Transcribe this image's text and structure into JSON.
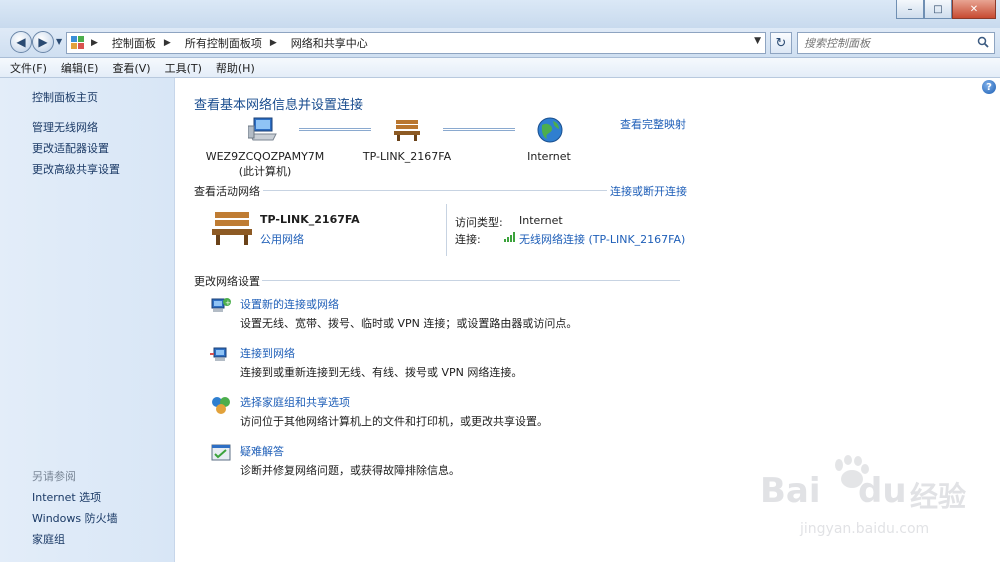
{
  "window": {
    "minimize": "–",
    "maximize": "□",
    "close": "✕"
  },
  "address": {
    "crumbs": [
      "控制面板",
      "所有控制面板项",
      "网络和共享中心"
    ],
    "search_placeholder": "搜索控制面板"
  },
  "menu": [
    "文件(F)",
    "编辑(E)",
    "查看(V)",
    "工具(T)",
    "帮助(H)"
  ],
  "sidebar": {
    "home": "控制面板主页",
    "links": [
      "管理无线网络",
      "更改适配器设置",
      "更改高级共享设置"
    ],
    "see_also_title": "另请参阅",
    "see_also": [
      "Internet 选项",
      "Windows 防火墙",
      "家庭组"
    ]
  },
  "main": {
    "title": "查看基本网络信息并设置连接",
    "view_full_map": "查看完整映射",
    "computer_name": "WEZ9ZCQOZPAMY7M",
    "computer_sub": "(此计算机)",
    "router_name": "TP-LINK_2167FA",
    "internet_label": "Internet",
    "active_title": "查看活动网络",
    "connect_disconnect": "连接或断开连接",
    "active_network_name": "TP-LINK_2167FA",
    "active_network_type": "公用网络",
    "access_type_label": "访问类型:",
    "access_type_value": "Internet",
    "connection_label": "连接:",
    "connection_value": "无线网络连接 (TP-LINK_2167FA)",
    "change_title": "更改网络设置",
    "tasks": [
      {
        "title": "设置新的连接或网络",
        "desc": "设置无线、宽带、拨号、临时或 VPN 连接；或设置路由器或访问点。",
        "icon": "new-connection-icon"
      },
      {
        "title": "连接到网络",
        "desc": "连接到或重新连接到无线、有线、拨号或 VPN 网络连接。",
        "icon": "connect-network-icon"
      },
      {
        "title": "选择家庭组和共享选项",
        "desc": "访问位于其他网络计算机上的文件和打印机，或更改共享设置。",
        "icon": "homegroup-icon"
      },
      {
        "title": "疑难解答",
        "desc": "诊断并修复网络问题，或获得故障排除信息。",
        "icon": "troubleshoot-icon"
      }
    ]
  },
  "watermark": {
    "brand": "Bai",
    "brand2": "du",
    "cn": "经验",
    "url": "jingyan.baidu.com"
  },
  "colors": {
    "link": "#1f5fb8",
    "title": "#1a4d8f",
    "sidebar_bg": "#dde9f7"
  }
}
